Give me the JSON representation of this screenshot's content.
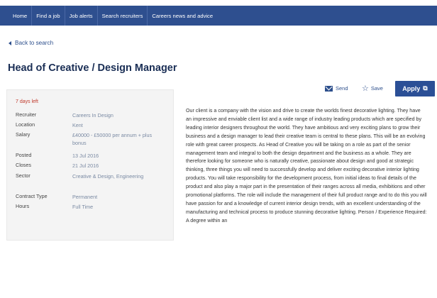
{
  "nav": {
    "items": [
      "Home",
      "Find a job",
      "Job alerts",
      "Search recruiters",
      "Careers news and advice"
    ]
  },
  "back_label": "Back to search",
  "job": {
    "title": "Head of Creative / Design Manager",
    "days_left": "7 days left",
    "details": [
      {
        "label": "Recruiter",
        "value": "Careers In Design"
      },
      {
        "label": "Location",
        "value": "Kent"
      },
      {
        "label": "Salary",
        "value": "£40000 - £50000 per annum + plus bonus"
      },
      {
        "label": "Posted",
        "value": "13 Jul 2016"
      },
      {
        "label": "Closes",
        "value": "21 Jul 2016"
      },
      {
        "label": "Sector",
        "value": "Creative & Design, Engineering"
      },
      {
        "label": "Contract Type",
        "value": "Permanent"
      },
      {
        "label": "Hours",
        "value": "Full Time"
      }
    ],
    "description": "Our client is a company with the vision and drive to create the worlds finest decorative lighting. They have an impressive and enviable client list and a wide range of industry leading products which are specified by leading interior designers throughout the world. They have ambitious and very exciting plans to grow their business and a design manager to lead their creative team is central to these plans. This will be an evolving role with great career prospects. As Head of Creative you will be taking on a role as part of the senior management team and integral to both the design department and the business as a whole. They are therefore looking for someone who is naturally creative, passionate about design and good at strategic thinking, three things you will need to successfully develop and deliver exciting decorative interior lighting products. You will take responsibility for the development process, from initial ideas to final details of the product and also play a major part in the presentation of their ranges across all media, exhibitions and other promotional platforms. The role will include the management of their full product range and to do this you will have passion for and a knowledge of current interior design trends, with an excellent understanding of the manufacturing and technical process to produce stunning decorative lighting. Person / Experience Required: A degree within an"
  },
  "actions": {
    "send": "Send",
    "save": "Save",
    "apply": "Apply"
  },
  "colors": {
    "nav_bg": "#2e4f8f",
    "title": "#1a2e55",
    "days_left": "#c0392b",
    "apply_bg": "#2b4f96"
  }
}
